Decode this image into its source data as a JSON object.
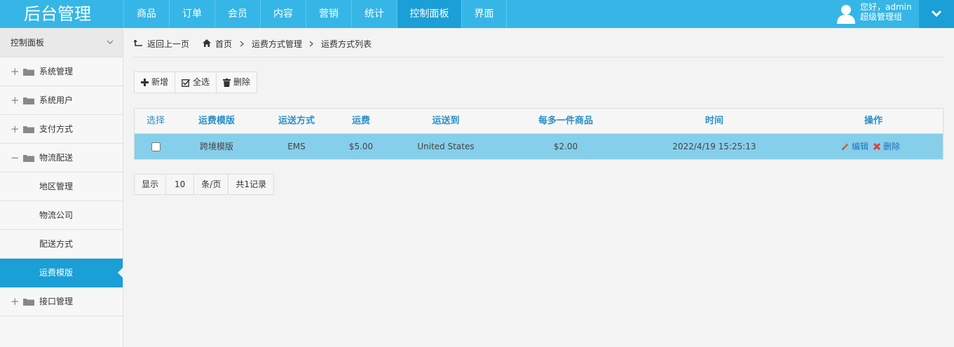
{
  "header": {
    "brand": "后台管理",
    "nav": [
      {
        "label": "商品",
        "active": false
      },
      {
        "label": "订单",
        "active": false
      },
      {
        "label": "会员",
        "active": false
      },
      {
        "label": "内容",
        "active": false
      },
      {
        "label": "营销",
        "active": false
      },
      {
        "label": "统计",
        "active": false
      },
      {
        "label": "控制面板",
        "active": true
      },
      {
        "label": "界面",
        "active": false
      }
    ],
    "user": {
      "greeting": "您好，admin",
      "group": "超级管理组"
    }
  },
  "sidebar": {
    "title": "控制面板",
    "items": [
      {
        "label": "系统管理",
        "sign": "+",
        "folder": true
      },
      {
        "label": "系统用户",
        "sign": "+",
        "folder": true
      },
      {
        "label": "支付方式",
        "sign": "+",
        "folder": true
      },
      {
        "label": "物流配送",
        "sign": "−",
        "folder": true
      },
      {
        "label": "地区管理",
        "sign": "",
        "folder": false
      },
      {
        "label": "物流公司",
        "sign": "",
        "folder": false
      },
      {
        "label": "配送方式",
        "sign": "",
        "folder": false
      },
      {
        "label": "运费模版",
        "sign": "",
        "folder": false,
        "active": true
      },
      {
        "label": "接口管理",
        "sign": "+",
        "folder": true
      }
    ]
  },
  "breadcrumb": {
    "back": "返回上一页",
    "home": "首页",
    "level1": "运费方式管理",
    "level2": "运费方式列表"
  },
  "toolbar": {
    "add": "新增",
    "select_all": "全选",
    "delete": "删除"
  },
  "table": {
    "headers": [
      "选择",
      "运费模版",
      "运送方式",
      "运费",
      "运送到",
      "每多一件商品",
      "时间",
      "操作"
    ],
    "rows": [
      {
        "checked": false,
        "template": "跨境模版",
        "method": "EMS",
        "fee": "$5.00",
        "destination": "United States",
        "extra": "$2.00",
        "time": "2022/4/19 15:25:13",
        "edit": "编辑",
        "delete": "删除"
      }
    ]
  },
  "pager": {
    "show": "显示",
    "size": "10",
    "unit": "条/页",
    "total": "共1记录"
  },
  "colors": {
    "header_bg": "#36b6e6",
    "active_bg": "#1a9fd6",
    "row_highlight": "#86cfea",
    "header_text": "#2a8fc9"
  }
}
